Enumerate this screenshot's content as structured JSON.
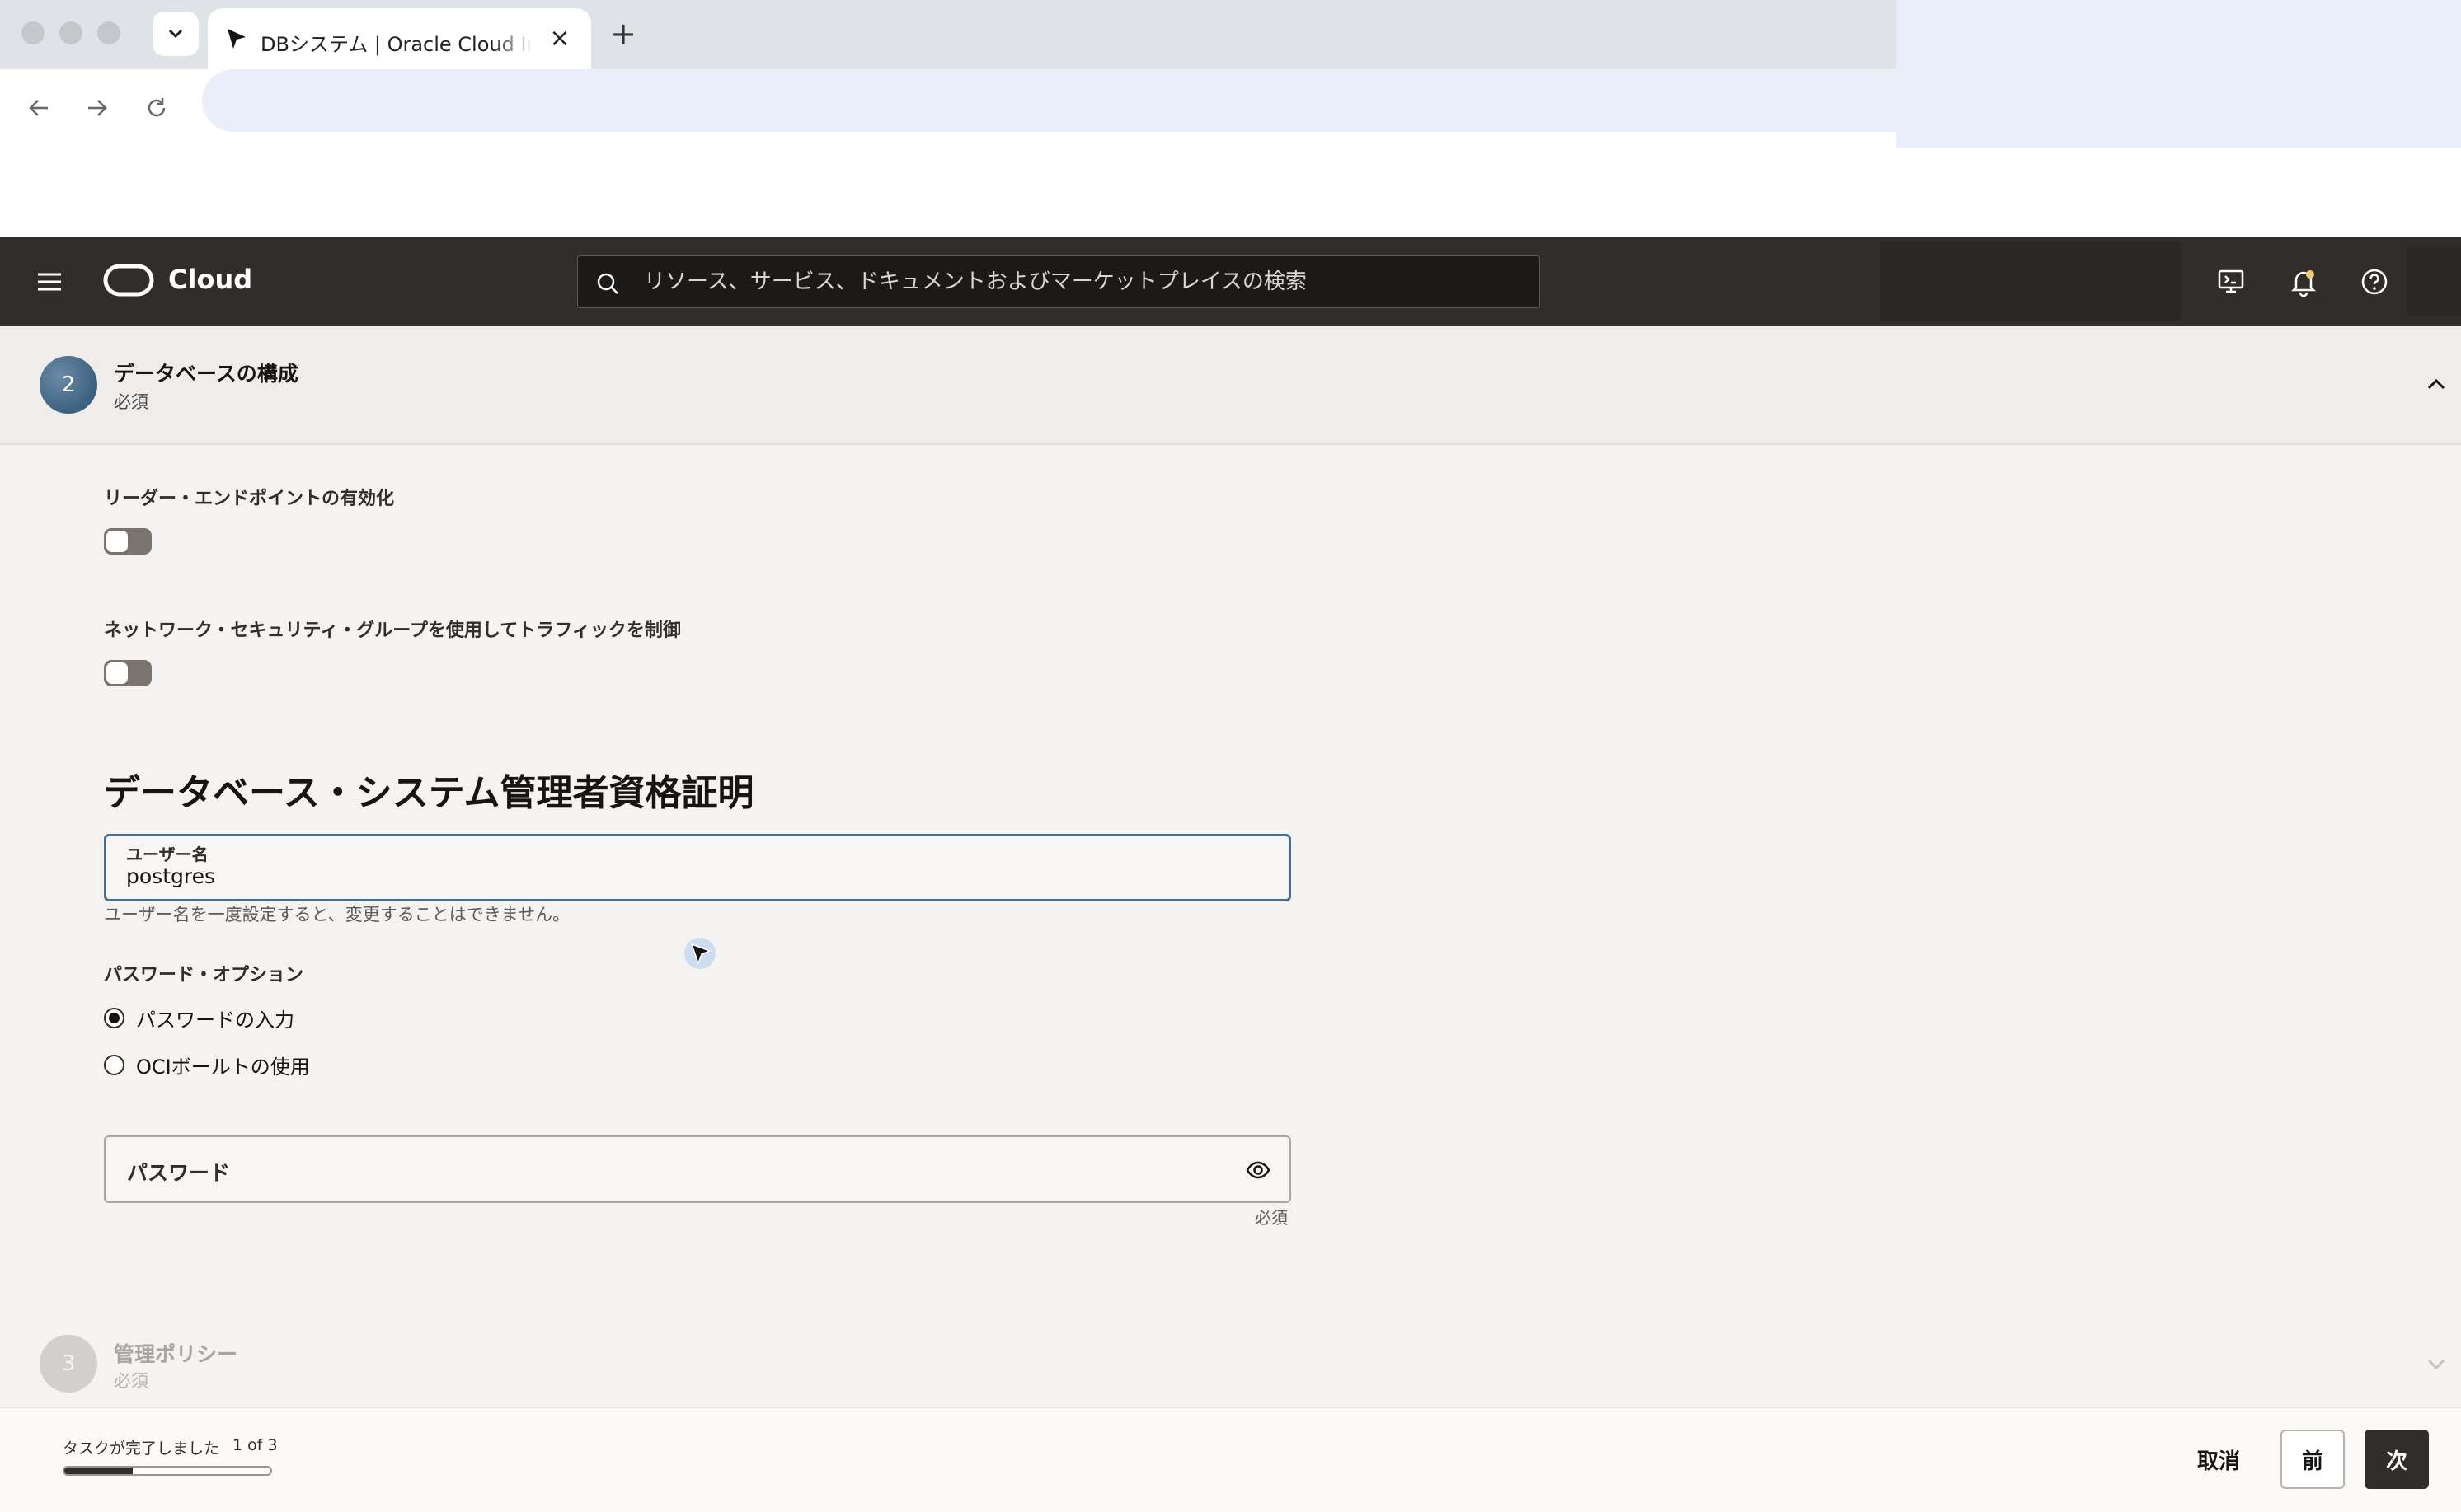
{
  "browser": {
    "tab_title": "DBシステム | Oracle Cloud Infr",
    "tab_close": "×",
    "new_tab": "+"
  },
  "header": {
    "brand": "Cloud",
    "search_placeholder": "リソース、サービス、ドキュメントおよびマーケットプレイスの検索"
  },
  "step2": {
    "number": "2",
    "title": "データベースの構成",
    "subtitle": "必須"
  },
  "form": {
    "reader_endpoint_label": "リーダー・エンドポイントの有効化",
    "nsg_label": "ネットワーク・セキュリティ・グループを使用してトラフィックを制御",
    "section_heading": "データベース・システム管理者資格証明",
    "username": {
      "label": "ユーザー名",
      "value": "postgres",
      "help": "ユーザー名を一度設定すると、変更することはできません。"
    },
    "password_options": {
      "label": "パスワード・オプション",
      "options": [
        {
          "label": "パスワードの入力",
          "checked": true
        },
        {
          "label": "OCIボールトの使用",
          "checked": false
        }
      ]
    },
    "password": {
      "label": "パスワード",
      "required": "必須"
    }
  },
  "step3": {
    "number": "3",
    "title": "管理ポリシー",
    "subtitle": "必須"
  },
  "footer": {
    "progress_text": "タスクが完了しました",
    "progress_count": "1 of 3",
    "progress_fraction": 0.33,
    "cancel": "取消",
    "prev": "前",
    "next": "次"
  },
  "colors": {
    "header_bg": "#312d2a",
    "accent_border": "#4a6d8c",
    "primary_button": "#312d2a"
  }
}
